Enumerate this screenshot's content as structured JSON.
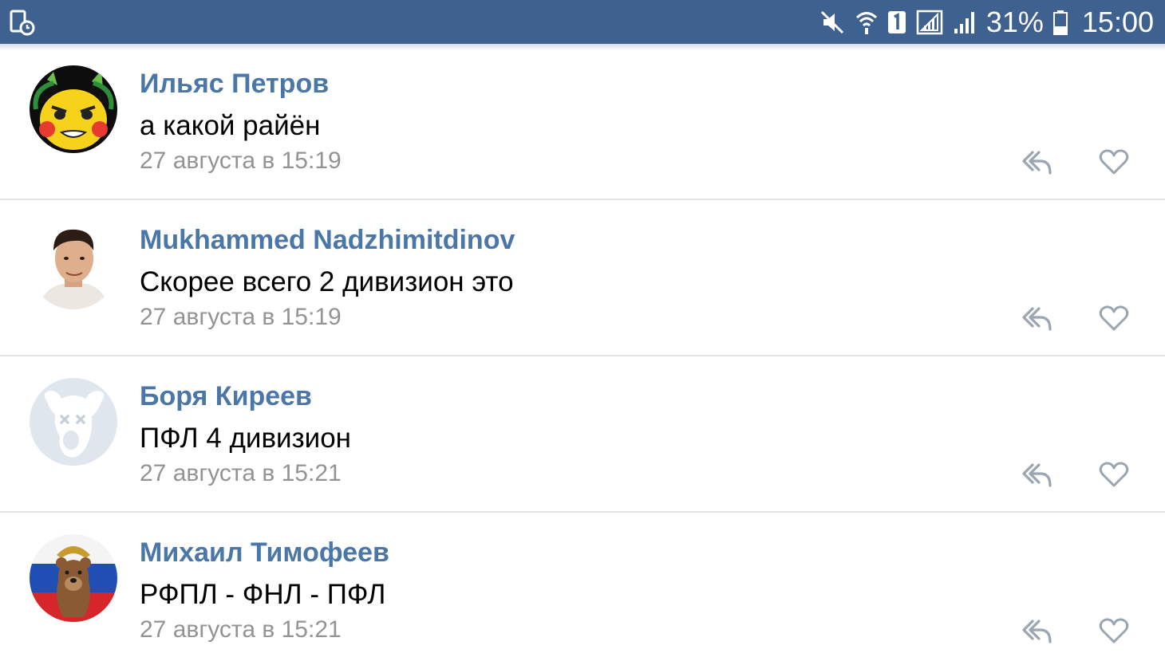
{
  "status_bar": {
    "battery_percent": "31%",
    "time": "15:00",
    "background_color": "#3f618f",
    "icons": [
      "screenshot-notification-icon",
      "mute-icon",
      "wifi-icon",
      "sim1-icon",
      "signal-sim1-icon",
      "signal-sim2-icon",
      "battery-icon"
    ],
    "battery_level": 0.31
  },
  "colors": {
    "name": "#4a76a8",
    "text": "#000000",
    "date": "#939393",
    "icon": "#9ba5b2",
    "divider": "#e3e4e6"
  },
  "comments": [
    {
      "author": "Ильяс Петров",
      "text": "а какой райён",
      "date": "27 августа в 15:19",
      "avatar": "pikachu-avatar"
    },
    {
      "author": "Mukhammed Nadzhimitdinov",
      "text": "Скорее всего 2 дивизион это",
      "date": "27 августа в 15:19",
      "avatar": "person-photo-avatar"
    },
    {
      "author": "Боря Киреев",
      "text": "ПФЛ 4 дивизион",
      "date": "27 августа в 15:21",
      "avatar": "deactivated-dog-avatar"
    },
    {
      "author": "Михаил Тимофеев",
      "text": "РФПЛ - ФНЛ - ПФЛ",
      "date": "27 августа в 15:21",
      "avatar": "bear-flag-avatar"
    }
  ]
}
